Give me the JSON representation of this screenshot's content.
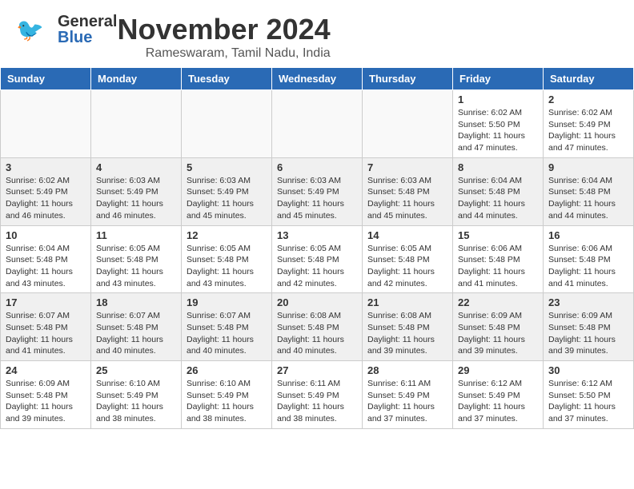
{
  "header": {
    "logo_general": "General",
    "logo_blue": "Blue",
    "title": "November 2024",
    "location": "Rameswaram, Tamil Nadu, India"
  },
  "weekdays": [
    "Sunday",
    "Monday",
    "Tuesday",
    "Wednesday",
    "Thursday",
    "Friday",
    "Saturday"
  ],
  "weeks": [
    [
      {
        "day": "",
        "info": ""
      },
      {
        "day": "",
        "info": ""
      },
      {
        "day": "",
        "info": ""
      },
      {
        "day": "",
        "info": ""
      },
      {
        "day": "",
        "info": ""
      },
      {
        "day": "1",
        "info": "Sunrise: 6:02 AM\nSunset: 5:50 PM\nDaylight: 11 hours and 47 minutes."
      },
      {
        "day": "2",
        "info": "Sunrise: 6:02 AM\nSunset: 5:49 PM\nDaylight: 11 hours and 47 minutes."
      }
    ],
    [
      {
        "day": "3",
        "info": "Sunrise: 6:02 AM\nSunset: 5:49 PM\nDaylight: 11 hours and 46 minutes."
      },
      {
        "day": "4",
        "info": "Sunrise: 6:03 AM\nSunset: 5:49 PM\nDaylight: 11 hours and 46 minutes."
      },
      {
        "day": "5",
        "info": "Sunrise: 6:03 AM\nSunset: 5:49 PM\nDaylight: 11 hours and 45 minutes."
      },
      {
        "day": "6",
        "info": "Sunrise: 6:03 AM\nSunset: 5:49 PM\nDaylight: 11 hours and 45 minutes."
      },
      {
        "day": "7",
        "info": "Sunrise: 6:03 AM\nSunset: 5:48 PM\nDaylight: 11 hours and 45 minutes."
      },
      {
        "day": "8",
        "info": "Sunrise: 6:04 AM\nSunset: 5:48 PM\nDaylight: 11 hours and 44 minutes."
      },
      {
        "day": "9",
        "info": "Sunrise: 6:04 AM\nSunset: 5:48 PM\nDaylight: 11 hours and 44 minutes."
      }
    ],
    [
      {
        "day": "10",
        "info": "Sunrise: 6:04 AM\nSunset: 5:48 PM\nDaylight: 11 hours and 43 minutes."
      },
      {
        "day": "11",
        "info": "Sunrise: 6:05 AM\nSunset: 5:48 PM\nDaylight: 11 hours and 43 minutes."
      },
      {
        "day": "12",
        "info": "Sunrise: 6:05 AM\nSunset: 5:48 PM\nDaylight: 11 hours and 43 minutes."
      },
      {
        "day": "13",
        "info": "Sunrise: 6:05 AM\nSunset: 5:48 PM\nDaylight: 11 hours and 42 minutes."
      },
      {
        "day": "14",
        "info": "Sunrise: 6:05 AM\nSunset: 5:48 PM\nDaylight: 11 hours and 42 minutes."
      },
      {
        "day": "15",
        "info": "Sunrise: 6:06 AM\nSunset: 5:48 PM\nDaylight: 11 hours and 41 minutes."
      },
      {
        "day": "16",
        "info": "Sunrise: 6:06 AM\nSunset: 5:48 PM\nDaylight: 11 hours and 41 minutes."
      }
    ],
    [
      {
        "day": "17",
        "info": "Sunrise: 6:07 AM\nSunset: 5:48 PM\nDaylight: 11 hours and 41 minutes."
      },
      {
        "day": "18",
        "info": "Sunrise: 6:07 AM\nSunset: 5:48 PM\nDaylight: 11 hours and 40 minutes."
      },
      {
        "day": "19",
        "info": "Sunrise: 6:07 AM\nSunset: 5:48 PM\nDaylight: 11 hours and 40 minutes."
      },
      {
        "day": "20",
        "info": "Sunrise: 6:08 AM\nSunset: 5:48 PM\nDaylight: 11 hours and 40 minutes."
      },
      {
        "day": "21",
        "info": "Sunrise: 6:08 AM\nSunset: 5:48 PM\nDaylight: 11 hours and 39 minutes."
      },
      {
        "day": "22",
        "info": "Sunrise: 6:09 AM\nSunset: 5:48 PM\nDaylight: 11 hours and 39 minutes."
      },
      {
        "day": "23",
        "info": "Sunrise: 6:09 AM\nSunset: 5:48 PM\nDaylight: 11 hours and 39 minutes."
      }
    ],
    [
      {
        "day": "24",
        "info": "Sunrise: 6:09 AM\nSunset: 5:48 PM\nDaylight: 11 hours and 39 minutes."
      },
      {
        "day": "25",
        "info": "Sunrise: 6:10 AM\nSunset: 5:49 PM\nDaylight: 11 hours and 38 minutes."
      },
      {
        "day": "26",
        "info": "Sunrise: 6:10 AM\nSunset: 5:49 PM\nDaylight: 11 hours and 38 minutes."
      },
      {
        "day": "27",
        "info": "Sunrise: 6:11 AM\nSunset: 5:49 PM\nDaylight: 11 hours and 38 minutes."
      },
      {
        "day": "28",
        "info": "Sunrise: 6:11 AM\nSunset: 5:49 PM\nDaylight: 11 hours and 37 minutes."
      },
      {
        "day": "29",
        "info": "Sunrise: 6:12 AM\nSunset: 5:49 PM\nDaylight: 11 hours and 37 minutes."
      },
      {
        "day": "30",
        "info": "Sunrise: 6:12 AM\nSunset: 5:50 PM\nDaylight: 11 hours and 37 minutes."
      }
    ]
  ],
  "shaded_weeks": [
    1,
    3
  ],
  "colors": {
    "header_bg": "#2a6ab5",
    "shaded_row": "#f0f0f0",
    "normal_row": "#ffffff"
  }
}
